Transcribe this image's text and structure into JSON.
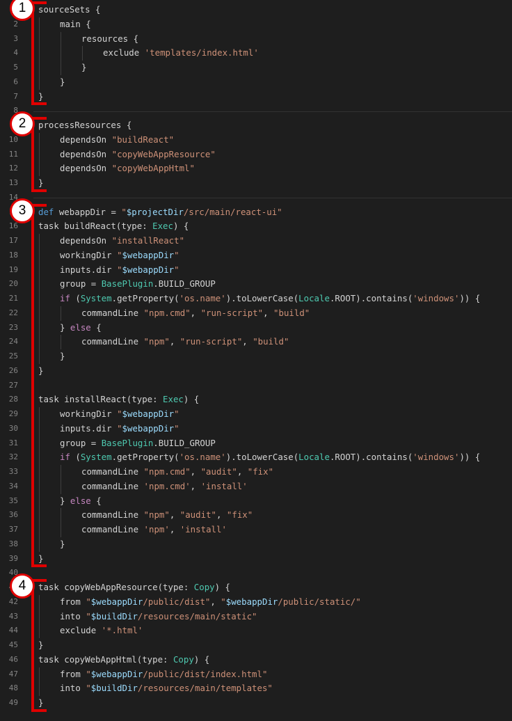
{
  "annotations": [
    {
      "label": "1",
      "first_line": 1,
      "last_line": 7
    },
    {
      "label": "2",
      "first_line": 9,
      "last_line": 13
    },
    {
      "label": "3",
      "first_line": 15,
      "last_line": 39
    },
    {
      "label": "4",
      "first_line": 41,
      "last_line": 49
    }
  ],
  "colors": {
    "background": "#1e1e1e",
    "annotation": "#e00000",
    "string": "#ce9178",
    "keyword": "#c586c0",
    "type": "#4ec9b0"
  },
  "code": [
    {
      "n": "1",
      "i": 0,
      "t": [
        [
          "p",
          "sourceSets {"
        ]
      ]
    },
    {
      "n": "2",
      "i": 1,
      "t": [
        [
          "p",
          "main {"
        ]
      ]
    },
    {
      "n": "3",
      "i": 2,
      "t": [
        [
          "p",
          "resources {"
        ]
      ]
    },
    {
      "n": "4",
      "i": 3,
      "t": [
        [
          "p",
          "exclude "
        ],
        [
          "s",
          "'templates/index.html'"
        ]
      ]
    },
    {
      "n": "5",
      "i": 2,
      "t": [
        [
          "p",
          "}"
        ]
      ]
    },
    {
      "n": "6",
      "i": 1,
      "t": [
        [
          "p",
          "}"
        ]
      ]
    },
    {
      "n": "7",
      "i": 0,
      "t": [
        [
          "p",
          "}"
        ]
      ]
    },
    {
      "n": "8",
      "i": 0,
      "t": []
    },
    {
      "n": "9",
      "i": 0,
      "t": [
        [
          "p",
          "processResources {"
        ]
      ]
    },
    {
      "n": "10",
      "i": 1,
      "t": [
        [
          "p",
          "dependsOn "
        ],
        [
          "s",
          "\"buildReact\""
        ]
      ]
    },
    {
      "n": "11",
      "i": 1,
      "t": [
        [
          "p",
          "dependsOn "
        ],
        [
          "s",
          "\"copyWebAppResource\""
        ]
      ]
    },
    {
      "n": "12",
      "i": 1,
      "t": [
        [
          "p",
          "dependsOn "
        ],
        [
          "s",
          "\"copyWebAppHtml\""
        ]
      ]
    },
    {
      "n": "13",
      "i": 0,
      "t": [
        [
          "p",
          "}"
        ]
      ]
    },
    {
      "n": "14",
      "i": 0,
      "t": []
    },
    {
      "n": "15",
      "i": 0,
      "t": [
        [
          "d",
          "def"
        ],
        [
          "p",
          " webappDir = "
        ],
        [
          "s",
          "\""
        ],
        [
          "v",
          "$projectDir"
        ],
        [
          "s",
          "/src/main/react-ui\""
        ]
      ]
    },
    {
      "n": "16",
      "i": 0,
      "t": [
        [
          "p",
          "task buildReact(type: "
        ],
        [
          "y",
          "Exec"
        ],
        [
          "p",
          ") {"
        ]
      ]
    },
    {
      "n": "17",
      "i": 1,
      "t": [
        [
          "p",
          "dependsOn "
        ],
        [
          "s",
          "\"installReact\""
        ]
      ]
    },
    {
      "n": "18",
      "i": 1,
      "t": [
        [
          "p",
          "workingDir "
        ],
        [
          "s",
          "\""
        ],
        [
          "v",
          "$webappDir"
        ],
        [
          "s",
          "\""
        ]
      ]
    },
    {
      "n": "19",
      "i": 1,
      "t": [
        [
          "p",
          "inputs.dir "
        ],
        [
          "s",
          "\""
        ],
        [
          "v",
          "$webappDir"
        ],
        [
          "s",
          "\""
        ]
      ]
    },
    {
      "n": "20",
      "i": 1,
      "t": [
        [
          "p",
          "group = "
        ],
        [
          "y",
          "BasePlugin"
        ],
        [
          "p",
          ".BUILD_GROUP"
        ]
      ]
    },
    {
      "n": "21",
      "i": 1,
      "t": [
        [
          "k",
          "if"
        ],
        [
          "p",
          " ("
        ],
        [
          "y",
          "System"
        ],
        [
          "p",
          ".getProperty("
        ],
        [
          "s",
          "'os.name'"
        ],
        [
          "p",
          ").toLowerCase("
        ],
        [
          "y",
          "Locale"
        ],
        [
          "p",
          ".ROOT).contains("
        ],
        [
          "s",
          "'windows'"
        ],
        [
          "p",
          ")) {"
        ]
      ]
    },
    {
      "n": "22",
      "i": 2,
      "t": [
        [
          "p",
          "commandLine "
        ],
        [
          "s",
          "\"npm.cmd\""
        ],
        [
          "p",
          ", "
        ],
        [
          "s",
          "\"run-script\""
        ],
        [
          "p",
          ", "
        ],
        [
          "s",
          "\"build\""
        ]
      ]
    },
    {
      "n": "23",
      "i": 1,
      "t": [
        [
          "p",
          "} "
        ],
        [
          "k",
          "else"
        ],
        [
          "p",
          " {"
        ]
      ]
    },
    {
      "n": "24",
      "i": 2,
      "t": [
        [
          "p",
          "commandLine "
        ],
        [
          "s",
          "\"npm\""
        ],
        [
          "p",
          ", "
        ],
        [
          "s",
          "\"run-script\""
        ],
        [
          "p",
          ", "
        ],
        [
          "s",
          "\"build\""
        ]
      ]
    },
    {
      "n": "25",
      "i": 1,
      "t": [
        [
          "p",
          "}"
        ]
      ]
    },
    {
      "n": "26",
      "i": 0,
      "t": [
        [
          "p",
          "}"
        ]
      ]
    },
    {
      "n": "27",
      "i": 0,
      "t": []
    },
    {
      "n": "28",
      "i": 0,
      "t": [
        [
          "p",
          "task installReact(type: "
        ],
        [
          "y",
          "Exec"
        ],
        [
          "p",
          ") {"
        ]
      ]
    },
    {
      "n": "29",
      "i": 1,
      "t": [
        [
          "p",
          "workingDir "
        ],
        [
          "s",
          "\""
        ],
        [
          "v",
          "$webappDir"
        ],
        [
          "s",
          "\""
        ]
      ]
    },
    {
      "n": "30",
      "i": 1,
      "t": [
        [
          "p",
          "inputs.dir "
        ],
        [
          "s",
          "\""
        ],
        [
          "v",
          "$webappDir"
        ],
        [
          "s",
          "\""
        ]
      ]
    },
    {
      "n": "31",
      "i": 1,
      "t": [
        [
          "p",
          "group = "
        ],
        [
          "y",
          "BasePlugin"
        ],
        [
          "p",
          ".BUILD_GROUP"
        ]
      ]
    },
    {
      "n": "32",
      "i": 1,
      "t": [
        [
          "k",
          "if"
        ],
        [
          "p",
          " ("
        ],
        [
          "y",
          "System"
        ],
        [
          "p",
          ".getProperty("
        ],
        [
          "s",
          "'os.name'"
        ],
        [
          "p",
          ").toLowerCase("
        ],
        [
          "y",
          "Locale"
        ],
        [
          "p",
          ".ROOT).contains("
        ],
        [
          "s",
          "'windows'"
        ],
        [
          "p",
          ")) {"
        ]
      ]
    },
    {
      "n": "33",
      "i": 2,
      "t": [
        [
          "p",
          "commandLine "
        ],
        [
          "s",
          "\"npm.cmd\""
        ],
        [
          "p",
          ", "
        ],
        [
          "s",
          "\"audit\""
        ],
        [
          "p",
          ", "
        ],
        [
          "s",
          "\"fix\""
        ]
      ]
    },
    {
      "n": "34",
      "i": 2,
      "t": [
        [
          "p",
          "commandLine "
        ],
        [
          "s",
          "'npm.cmd'"
        ],
        [
          "p",
          ", "
        ],
        [
          "s",
          "'install'"
        ]
      ]
    },
    {
      "n": "35",
      "i": 1,
      "t": [
        [
          "p",
          "} "
        ],
        [
          "k",
          "else"
        ],
        [
          "p",
          " {"
        ]
      ]
    },
    {
      "n": "36",
      "i": 2,
      "t": [
        [
          "p",
          "commandLine "
        ],
        [
          "s",
          "\"npm\""
        ],
        [
          "p",
          ", "
        ],
        [
          "s",
          "\"audit\""
        ],
        [
          "p",
          ", "
        ],
        [
          "s",
          "\"fix\""
        ]
      ]
    },
    {
      "n": "37",
      "i": 2,
      "t": [
        [
          "p",
          "commandLine "
        ],
        [
          "s",
          "'npm'"
        ],
        [
          "p",
          ", "
        ],
        [
          "s",
          "'install'"
        ]
      ]
    },
    {
      "n": "38",
      "i": 1,
      "t": [
        [
          "p",
          "}"
        ]
      ]
    },
    {
      "n": "39",
      "i": 0,
      "t": [
        [
          "p",
          "}"
        ]
      ]
    },
    {
      "n": "40",
      "i": 0,
      "t": []
    },
    {
      "n": "41",
      "i": 0,
      "t": [
        [
          "p",
          "task copyWebAppResource(type: "
        ],
        [
          "y",
          "Copy"
        ],
        [
          "p",
          ") {"
        ]
      ]
    },
    {
      "n": "42",
      "i": 1,
      "t": [
        [
          "p",
          "from "
        ],
        [
          "s",
          "\""
        ],
        [
          "v",
          "$webappDir"
        ],
        [
          "s",
          "/public/dist\""
        ],
        [
          "p",
          ", "
        ],
        [
          "s",
          "\""
        ],
        [
          "v",
          "$webappDir"
        ],
        [
          "s",
          "/public/static/\""
        ]
      ]
    },
    {
      "n": "43",
      "i": 1,
      "t": [
        [
          "p",
          "into "
        ],
        [
          "s",
          "\""
        ],
        [
          "v",
          "$buildDir"
        ],
        [
          "s",
          "/resources/main/static\""
        ]
      ]
    },
    {
      "n": "44",
      "i": 1,
      "t": [
        [
          "p",
          "exclude "
        ],
        [
          "s",
          "'*.html'"
        ]
      ]
    },
    {
      "n": "45",
      "i": 0,
      "t": [
        [
          "p",
          "}"
        ]
      ]
    },
    {
      "n": "46",
      "i": 0,
      "t": [
        [
          "p",
          "task copyWebAppHtml(type: "
        ],
        [
          "y",
          "Copy"
        ],
        [
          "p",
          ") {"
        ]
      ]
    },
    {
      "n": "47",
      "i": 1,
      "t": [
        [
          "p",
          "from "
        ],
        [
          "s",
          "\""
        ],
        [
          "v",
          "$webappDir"
        ],
        [
          "s",
          "/public/dist/index.html\""
        ]
      ]
    },
    {
      "n": "48",
      "i": 1,
      "t": [
        [
          "p",
          "into "
        ],
        [
          "s",
          "\""
        ],
        [
          "v",
          "$buildDir"
        ],
        [
          "s",
          "/resources/main/templates\""
        ]
      ]
    },
    {
      "n": "49",
      "i": 0,
      "t": [
        [
          "p",
          "}"
        ]
      ]
    }
  ]
}
